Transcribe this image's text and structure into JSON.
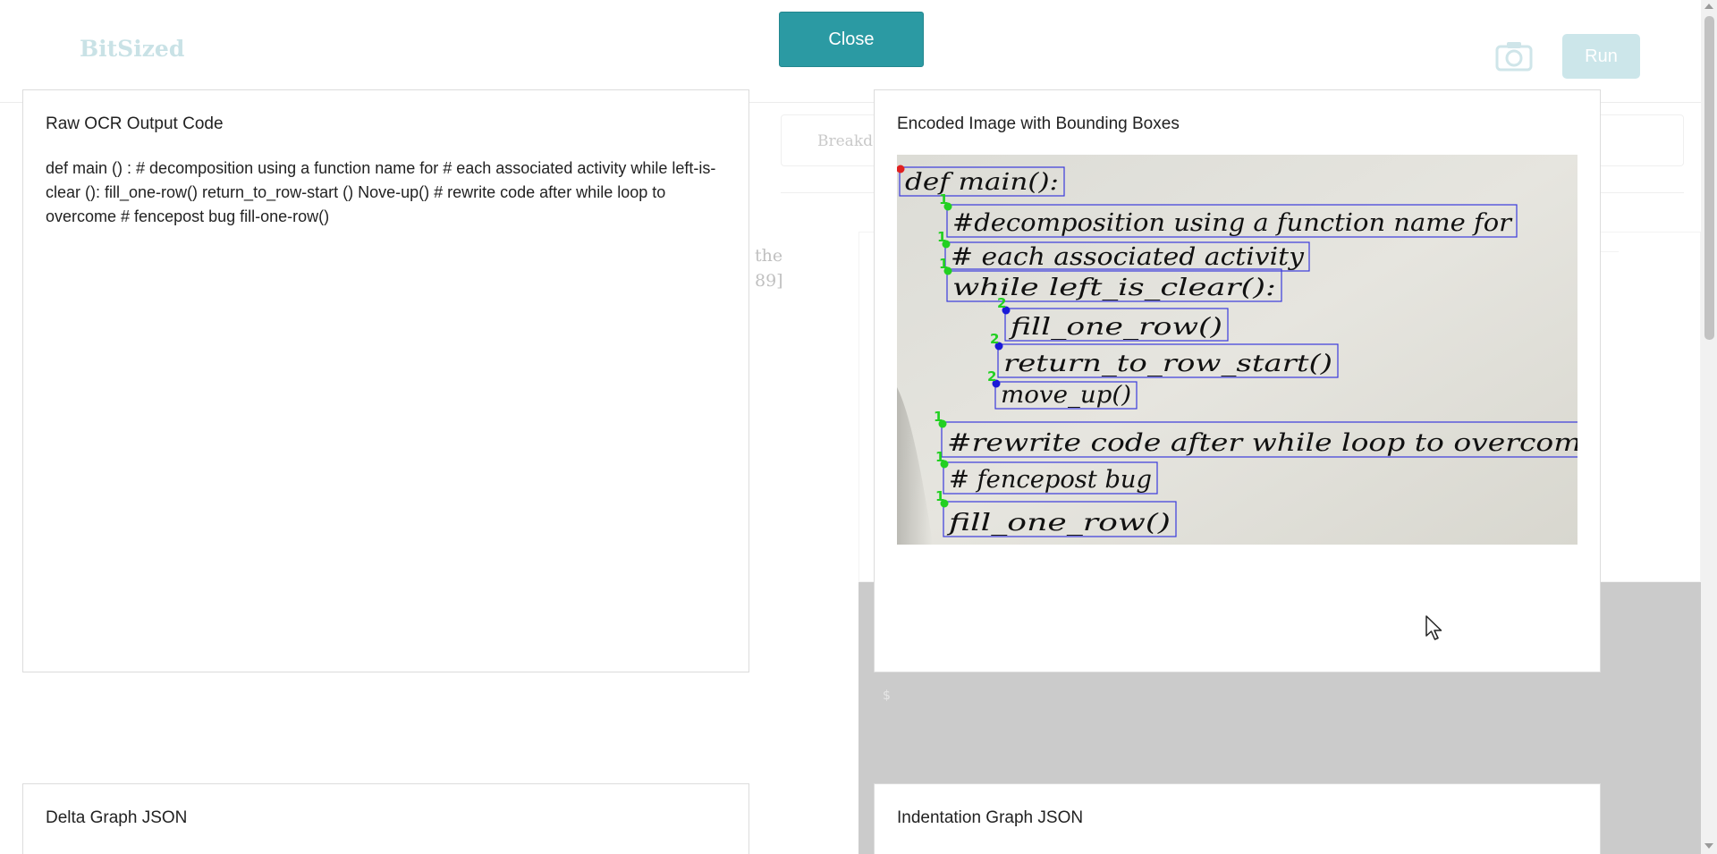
{
  "app": {
    "logo": "BitSized",
    "run_label": "Run",
    "breakdown_label": "Breakdo",
    "bg_text_line1": "the",
    "bg_text_line2": "89]",
    "bg_dollar": "$",
    "icons": {
      "camera": "camera-icon",
      "cursor": "mouse-pointer-icon"
    }
  },
  "modal": {
    "close_label": "Close",
    "ocr_card": {
      "title": "Raw OCR Output Code",
      "text": "def main () : # decomposition using a function name for # each associated activity while left-is-clear (): fill_one-row() return_to_row-start () Nove-up() # rewrite code after while loop to overcome # fencepost bug fill-one-row()"
    },
    "image_card": {
      "title": "Encoded Image with Bounding Boxes",
      "lines": [
        {
          "text": "def main():",
          "level": ""
        },
        {
          "text": "#decomposition using a function name for",
          "level": "1"
        },
        {
          "text": "# each associated activity",
          "level": "1"
        },
        {
          "text": "while left_is_clear():",
          "level": "1"
        },
        {
          "text": "fill_one_row()",
          "level": "2"
        },
        {
          "text": "return_to_row_start()",
          "level": "2"
        },
        {
          "text": "move_up()",
          "level": "2"
        },
        {
          "text": "#rewrite code after while loop to overcome",
          "level": "1"
        },
        {
          "text": "# fencepost bug",
          "level": "1"
        },
        {
          "text": "fill_one_row()",
          "level": "1"
        }
      ]
    },
    "delta_card": {
      "title": "Delta Graph JSON"
    },
    "indent_card": {
      "title": "Indentation Graph JSON"
    }
  },
  "colors": {
    "accent": "#2b9aa3",
    "box_stroke": "#3a3adc",
    "marker_level1": "#22d022",
    "marker_level2": "#1a1ad8",
    "marker_root": "#e02020",
    "dim_gray": "#cbcbcb"
  }
}
